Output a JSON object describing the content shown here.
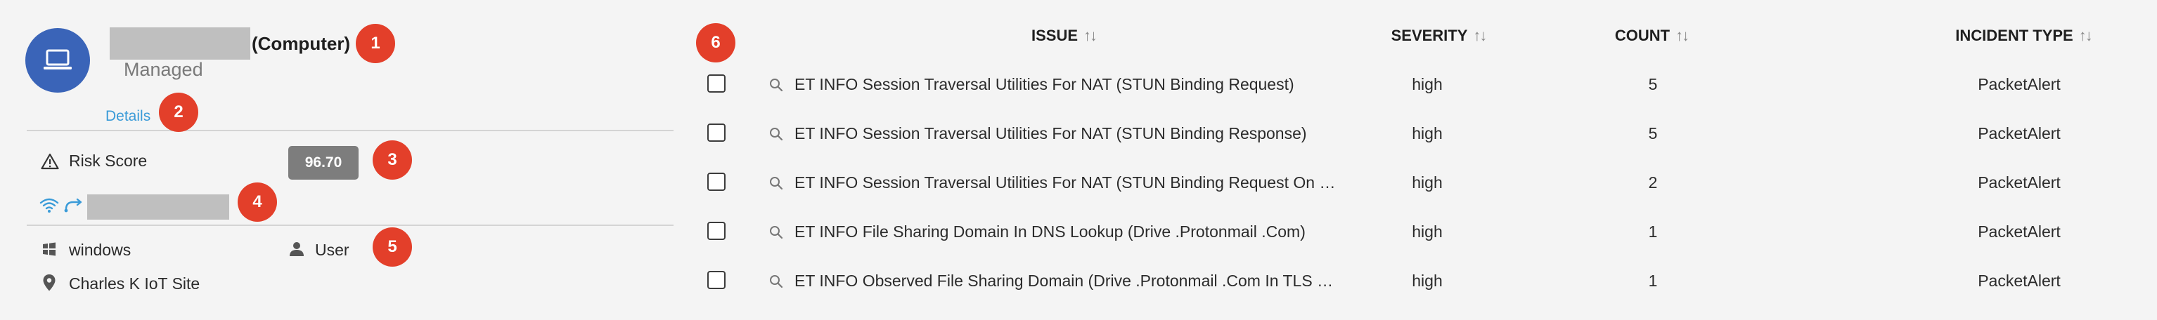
{
  "device": {
    "type_label": "(Computer)",
    "status": "Managed",
    "details_link": "Details",
    "risk_label": "Risk Score",
    "risk_score": "96.70",
    "os": "windows",
    "user": "User",
    "site": "Charles K IoT Site",
    "avatar_icon": "laptop-icon",
    "accent_color": "#3a64b8"
  },
  "badges": [
    "1",
    "2",
    "3",
    "4",
    "5",
    "6"
  ],
  "table": {
    "columns": [
      "ISSUE",
      "SEVERITY",
      "COUNT",
      "INCIDENT TYPE"
    ],
    "sort_glyph": "↑↓",
    "rows": [
      {
        "issue": "ET INFO Session Traversal Utilities For NAT (STUN Binding Request)",
        "severity": "high",
        "count": "5",
        "incident_type": "PacketAlert"
      },
      {
        "issue": "ET INFO Session Traversal Utilities For NAT (STUN Binding Response)",
        "severity": "high",
        "count": "5",
        "incident_type": "PacketAlert"
      },
      {
        "issue": "ET INFO Session Traversal Utilities For NAT (STUN Binding Request On …",
        "severity": "high",
        "count": "2",
        "incident_type": "PacketAlert"
      },
      {
        "issue": "ET INFO File Sharing Domain In DNS Lookup (Drive .Protonmail .Com)",
        "severity": "high",
        "count": "1",
        "incident_type": "PacketAlert"
      },
      {
        "issue": "ET INFO Observed File Sharing Domain (Drive .Protonmail .Com In TLS …",
        "severity": "high",
        "count": "1",
        "incident_type": "PacketAlert"
      }
    ]
  },
  "colors": {
    "badge": "#e33f2a",
    "link": "#3a9bd8",
    "risk_box": "#7d7d7d",
    "background": "#f4f4f4"
  }
}
